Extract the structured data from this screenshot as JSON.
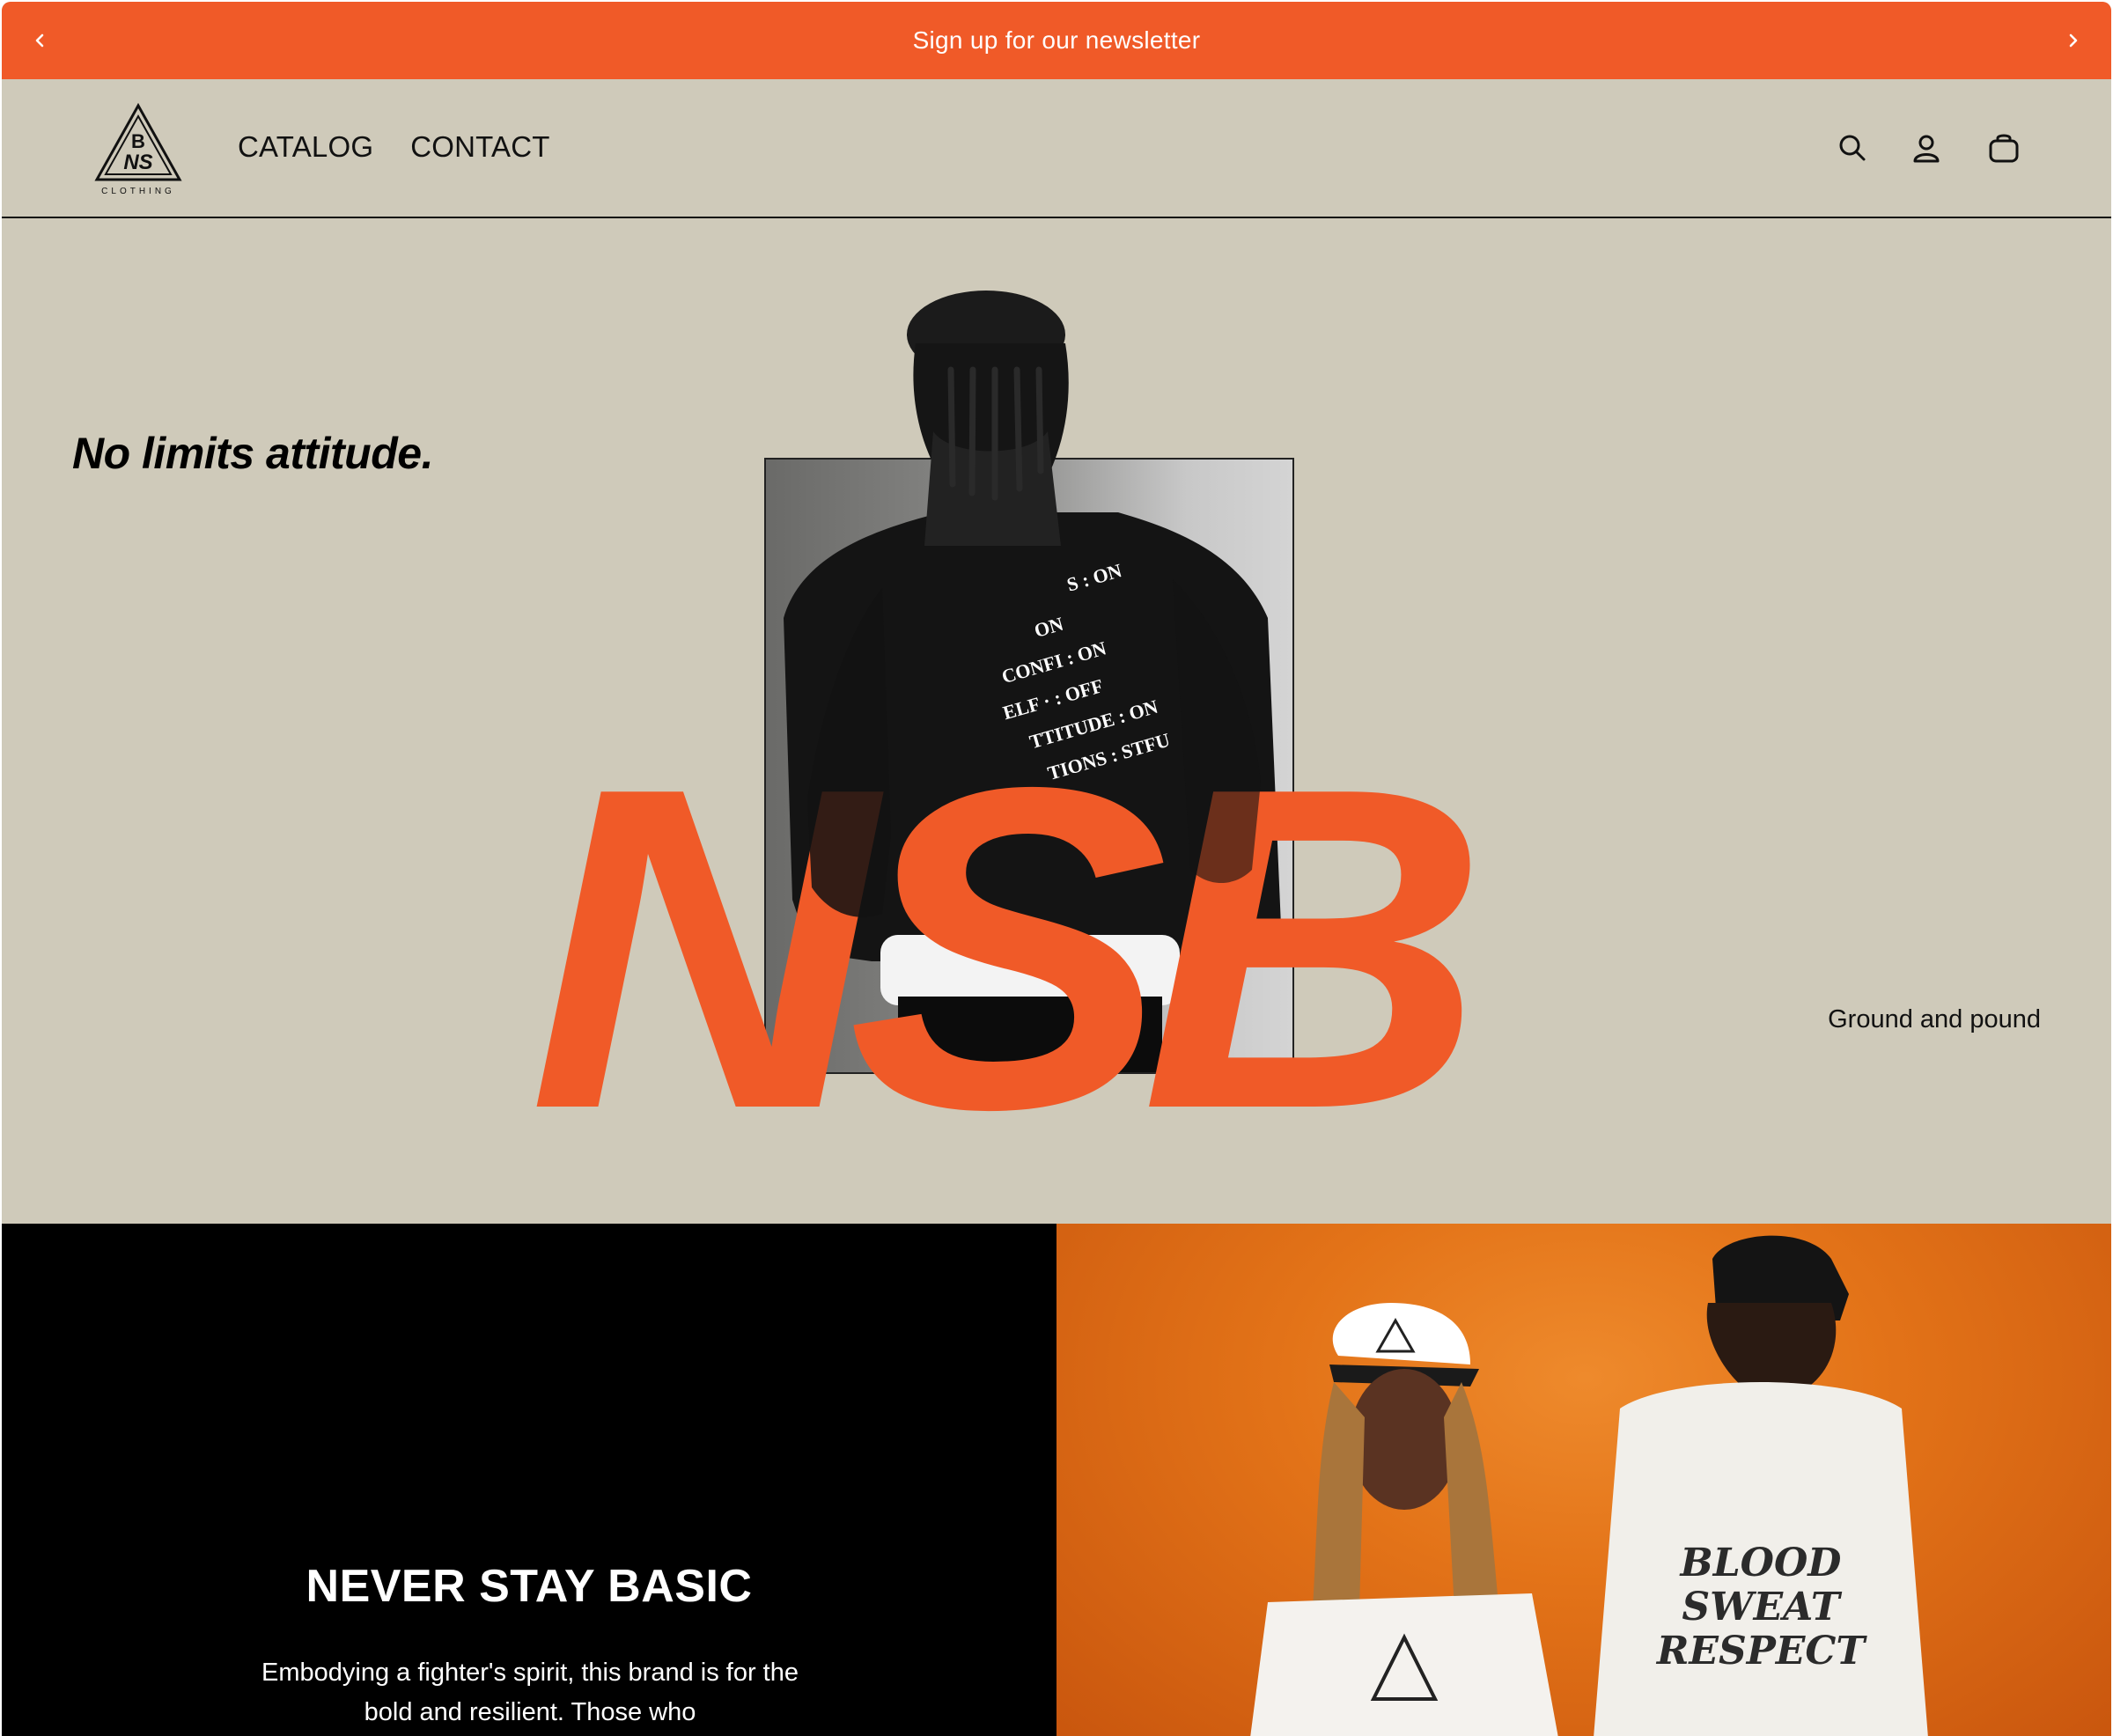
{
  "announcement": {
    "text": "Sign up for our newsletter"
  },
  "header": {
    "logo_text": "CLOTHING",
    "nav": [
      {
        "label": "CATALOG"
      },
      {
        "label": "CONTACT"
      }
    ],
    "icons": [
      "search-icon",
      "account-icon",
      "cart-icon"
    ]
  },
  "hero": {
    "tagline": "No limits attitude.",
    "big_text": "NSB",
    "caption": "Ground and pound",
    "accent_color": "#f05a28",
    "background_color": "#cfcaba"
  },
  "feature": {
    "title": "NEVER STAY BASIC",
    "body": "Embodying a fighter's spirit, this brand is for the bold and resilient. Those who",
    "shirt_text": [
      "BLOOD",
      "SWEAT",
      "RESPECT"
    ]
  }
}
